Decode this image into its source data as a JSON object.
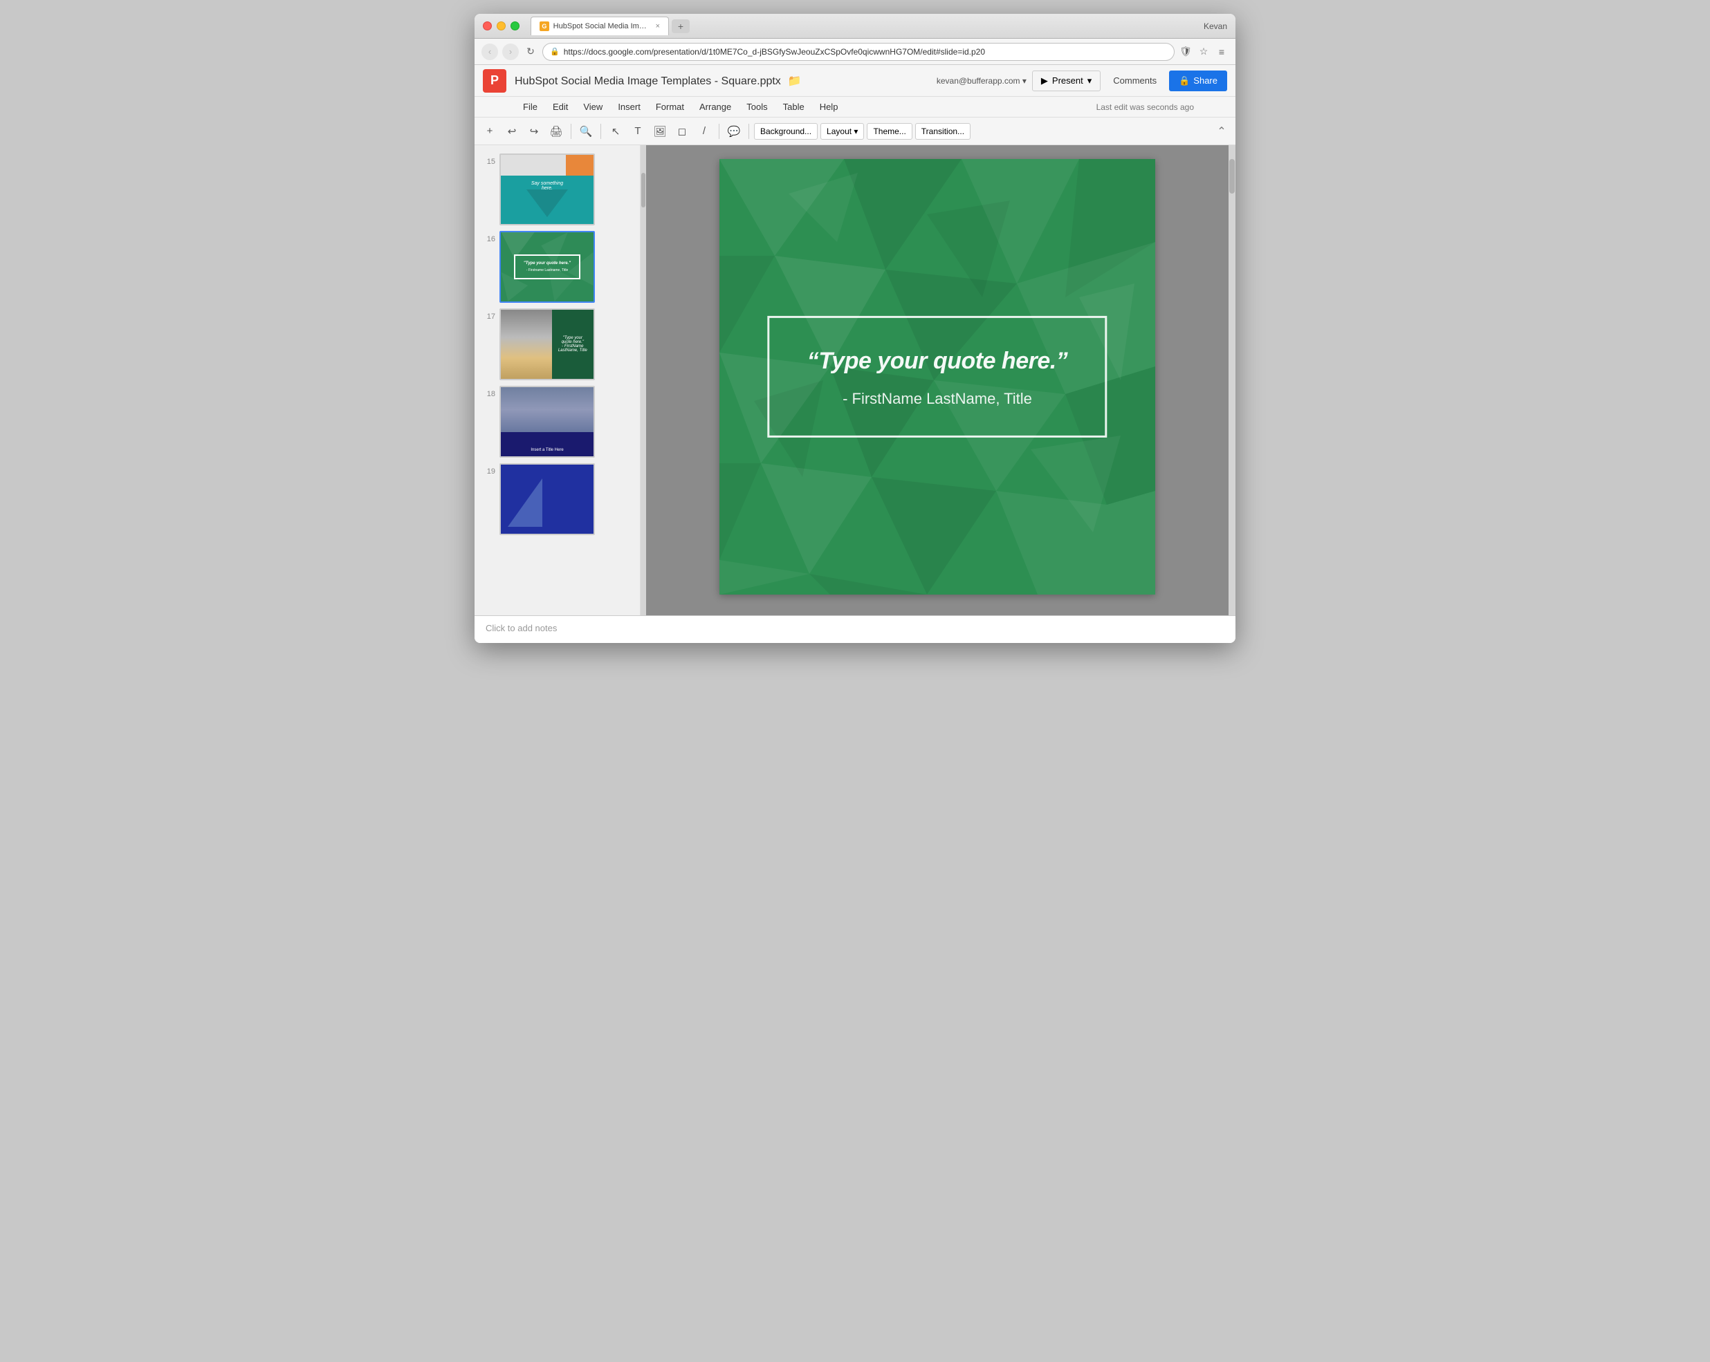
{
  "window": {
    "title": "HubSpot Social Media Image Templates - Square.pptx",
    "user": "Kevan"
  },
  "tab": {
    "label": "HubSpot Social Media Ima…",
    "icon": "G"
  },
  "addressbar": {
    "url": "https://docs.google.com/presentation/d/1t0ME7Co_d-jBSGfySwJeouZxCSpOvfe0qicwwnHG7OM/edit#slide=id.p20"
  },
  "appheader": {
    "logo": "P",
    "title": "HubSpot Social Media Image Templates - Square.pptx",
    "user_email": "kevan@bufferapp.com ▾",
    "present_label": "Present",
    "comments_label": "Comments",
    "share_label": "Share"
  },
  "menubar": {
    "items": [
      "File",
      "Edit",
      "View",
      "Insert",
      "Format",
      "Arrange",
      "Tools",
      "Table",
      "Help"
    ],
    "last_edit": "Last edit was seconds ago"
  },
  "toolbar": {
    "background_label": "Background...",
    "layout_label": "Layout ▾",
    "theme_label": "Theme...",
    "transition_label": "Transition..."
  },
  "slides": [
    {
      "number": "15",
      "type": "teal-arrow"
    },
    {
      "number": "16",
      "type": "green-quote",
      "active": true,
      "quote": "\"Type your quote here.\"",
      "author": "- Firstname Lastname, Title"
    },
    {
      "number": "17",
      "type": "photo-quote"
    },
    {
      "number": "18",
      "type": "photo-title",
      "title": "Insert a Title Here"
    },
    {
      "number": "19",
      "type": "blue-triangle"
    }
  ],
  "main_slide": {
    "quote": "“Type your quote here.”",
    "author": "- FirstName LastName, Title"
  },
  "notes": {
    "placeholder": "Click to add notes"
  }
}
